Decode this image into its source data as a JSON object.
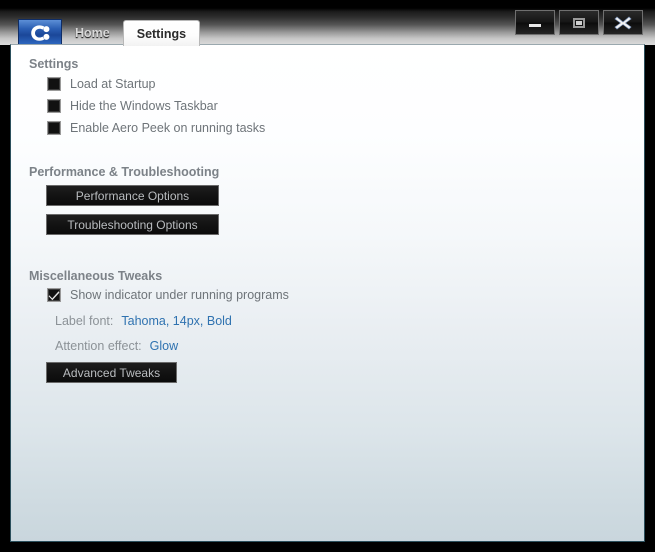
{
  "window": {
    "controls": [
      {
        "name": "minimize",
        "glyph": "minimize-icon"
      },
      {
        "name": "maximize",
        "glyph": "maximize-icon"
      },
      {
        "name": "close",
        "glyph": "close-icon"
      }
    ]
  },
  "tabs": {
    "logo_icon": "app-logo-icon",
    "items": [
      {
        "label": "Home",
        "active": false
      },
      {
        "label": "Settings",
        "active": true
      }
    ]
  },
  "sections": {
    "settings": {
      "header": "Settings",
      "checkboxes": [
        {
          "label": "Load at Startup",
          "checked": false
        },
        {
          "label": "Hide the Windows Taskbar",
          "checked": false
        },
        {
          "label": "Enable Aero Peek on running tasks",
          "checked": false
        }
      ]
    },
    "performance": {
      "header": "Performance & Troubleshooting",
      "buttons": [
        {
          "label": "Performance Options"
        },
        {
          "label": "Troubleshooting Options"
        }
      ]
    },
    "misc": {
      "header": "Miscellaneous Tweaks",
      "checkbox": {
        "label": "Show indicator under running programs",
        "checked": true
      },
      "label_font": {
        "label": "Label font:",
        "value": "Tahoma, 14px, Bold"
      },
      "attention_effect": {
        "label": "Attention effect:",
        "value": "Glow"
      },
      "advanced_button": {
        "label": "Advanced Tweaks"
      }
    }
  },
  "colors": {
    "link": "#2f72b0",
    "muted_text": "#6e7479",
    "header_text": "#7c8288",
    "button_bg": "#131313",
    "accent_blue": "#2b5fb3"
  }
}
